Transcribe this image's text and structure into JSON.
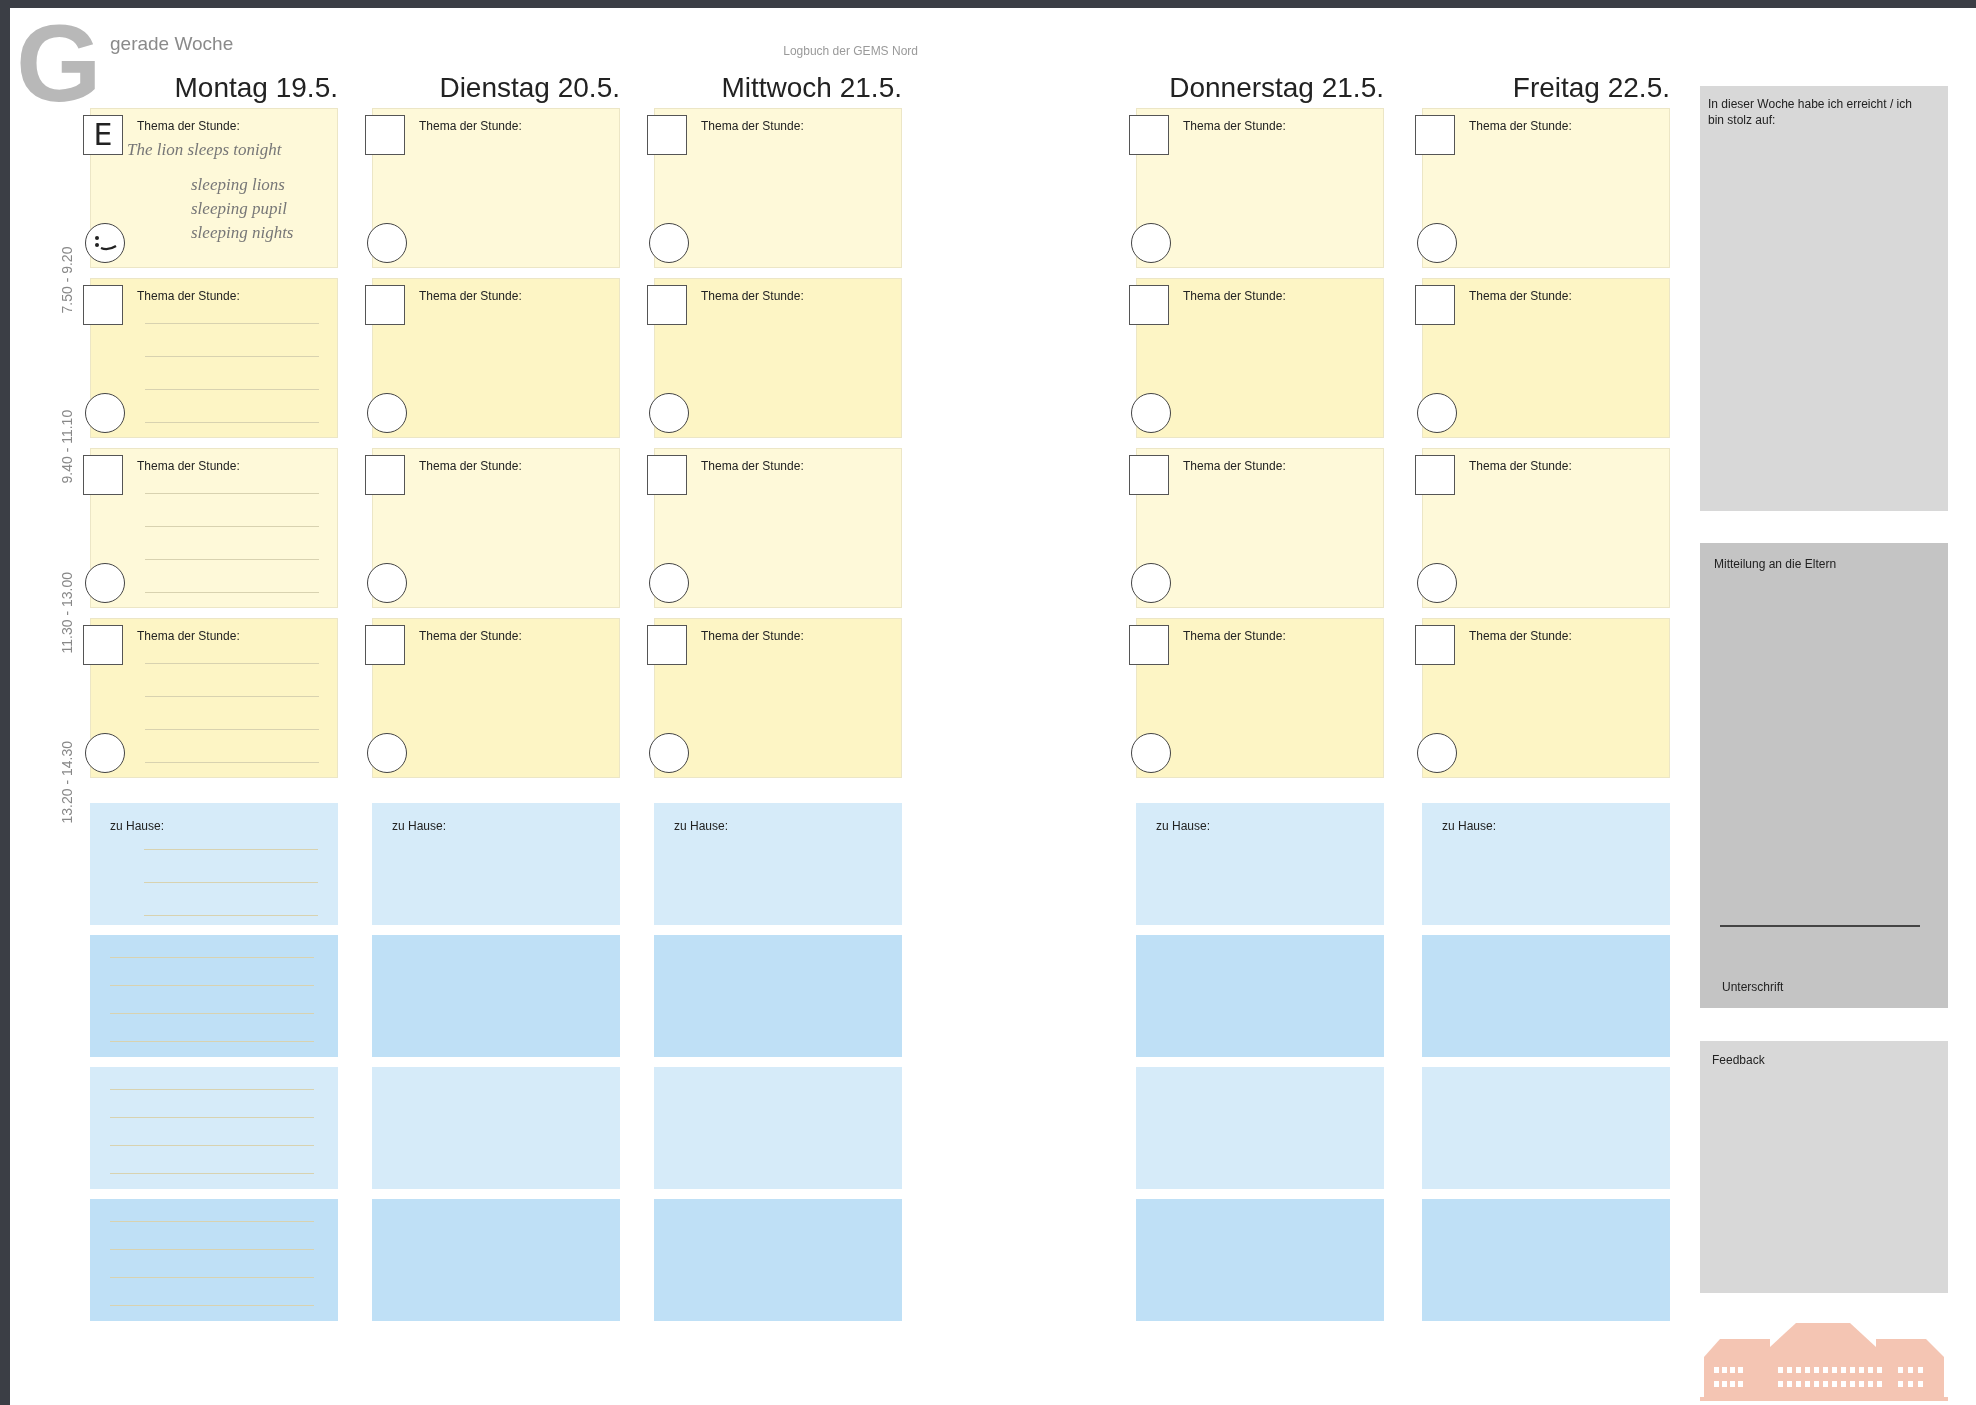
{
  "page": {
    "letter": "G",
    "week": "gerade Woche",
    "title": "Logbuch der GEMS Nord"
  },
  "times": [
    "7.50 - 9.20",
    "9.40 - 11.10",
    "11.30 - 13.00",
    "13.20 - 14.30"
  ],
  "days": [
    {
      "heading": "Montag 19.5.",
      "lessons": [
        {
          "label": "Thema der Stunde:",
          "box_text": "E",
          "notes": [
            "The lion sleeps tonight"
          ],
          "extra_notes": [
            "sleeping lions",
            "sleeping pupil",
            "sleeping nights"
          ],
          "smiley": true,
          "ruled": false
        },
        {
          "label": "Thema der Stunde:",
          "checked": false,
          "smiley": false,
          "ruled": true
        },
        {
          "label": "Thema der Stunde:",
          "checked": false,
          "smiley": false,
          "ruled": true
        },
        {
          "label": "Thema der Stunde:",
          "checked": false,
          "smiley": false,
          "ruled": true
        }
      ],
      "homework": [
        {
          "label": "zu Hause:",
          "ruled": true
        },
        {
          "ruled": true
        },
        {
          "ruled": true
        },
        {
          "ruled": true
        }
      ]
    },
    {
      "heading": "Dienstag 20.5.",
      "lessons": [
        {
          "label": "Thema der Stunde:",
          "checked": false,
          "smiley": false,
          "ruled": false
        },
        {
          "label": "Thema der Stunde:",
          "checked": false,
          "smiley": false,
          "ruled": false
        },
        {
          "label": "Thema der Stunde:",
          "checked": false,
          "smiley": false,
          "ruled": false
        },
        {
          "label": "Thema der Stunde:",
          "checked": false,
          "smiley": false,
          "ruled": false
        }
      ],
      "homework": [
        {
          "label": "zu Hause:",
          "ruled": false
        },
        {
          "ruled": false
        },
        {
          "ruled": false
        },
        {
          "ruled": false
        }
      ]
    },
    {
      "heading": "Mittwoch 21.5.",
      "lessons": [
        {
          "label": "Thema der Stunde:",
          "checked": false,
          "smiley": false,
          "ruled": false
        },
        {
          "label": "Thema der Stunde:",
          "checked": false,
          "smiley": false,
          "ruled": false
        },
        {
          "label": "Thema der Stunde:",
          "checked": false,
          "smiley": false,
          "ruled": false
        },
        {
          "label": "Thema der Stunde:",
          "checked": false,
          "smiley": false,
          "ruled": false
        }
      ],
      "homework": [
        {
          "label": "zu Hause:",
          "ruled": false
        },
        {
          "ruled": false
        },
        {
          "ruled": false
        },
        {
          "ruled": false
        }
      ]
    },
    {
      "heading": "Donnerstag 21.5.",
      "lessons": [
        {
          "label": "Thema der Stunde:",
          "checked": false,
          "smiley": false,
          "ruled": false
        },
        {
          "label": "Thema der Stunde:",
          "checked": false,
          "smiley": false,
          "ruled": false
        },
        {
          "label": "Thema der Stunde:",
          "checked": false,
          "smiley": false,
          "ruled": false
        },
        {
          "label": "Thema der Stunde:",
          "checked": false,
          "smiley": false,
          "ruled": false
        }
      ],
      "homework": [
        {
          "label": "zu Hause:",
          "ruled": false
        },
        {
          "ruled": false
        },
        {
          "ruled": false
        },
        {
          "ruled": false
        }
      ]
    },
    {
      "heading": "Freitag 22.5.",
      "lessons": [
        {
          "label": "Thema der Stunde:",
          "checked": false,
          "smiley": false,
          "ruled": false
        },
        {
          "label": "Thema der Stunde:",
          "checked": false,
          "smiley": false,
          "ruled": false
        },
        {
          "label": "Thema der Stunde:",
          "checked": false,
          "smiley": false,
          "ruled": false
        },
        {
          "label": "Thema der Stunde:",
          "checked": false,
          "smiley": false,
          "ruled": false
        }
      ],
      "homework": [
        {
          "label": "zu Hause:",
          "ruled": false
        },
        {
          "ruled": false
        },
        {
          "ruled": false
        },
        {
          "ruled": false
        }
      ]
    }
  ],
  "side": {
    "achievement": {
      "label": "In dieser Woche habe ich erreicht / ich bin stolz auf:"
    },
    "parents": {
      "label": "Mitteilung an die Eltern",
      "signature": "Unterschrift"
    },
    "feedback": {
      "label": "Feedback"
    }
  }
}
